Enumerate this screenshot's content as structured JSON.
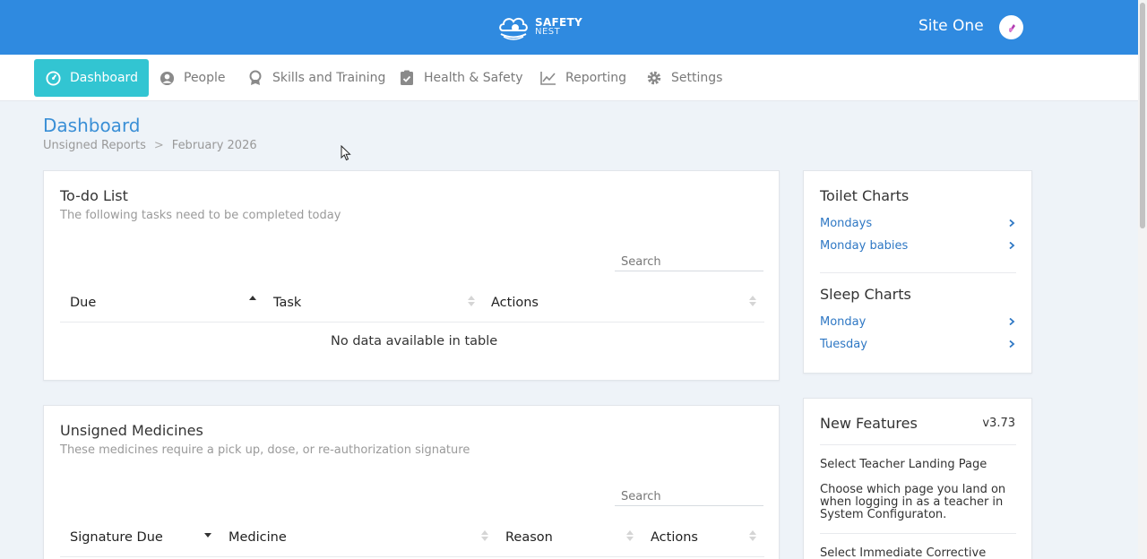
{
  "header": {
    "logo_line1": "SAFETY",
    "logo_line2": "NEST",
    "site_name": "Site One"
  },
  "nav": [
    {
      "label": "Dashboard",
      "icon": "dashboard-icon",
      "active": true
    },
    {
      "label": "People",
      "icon": "person-icon",
      "active": false
    },
    {
      "label": "Skills and Training",
      "icon": "award-icon",
      "active": false
    },
    {
      "label": "Health & Safety",
      "icon": "clipboard-check-icon",
      "active": false
    },
    {
      "label": "Reporting",
      "icon": "line-chart-icon",
      "active": false
    },
    {
      "label": "Settings",
      "icon": "gear-icon",
      "active": false
    }
  ],
  "page": {
    "title": "Dashboard",
    "breadcrumb": [
      "Unsigned Reports",
      "February 2026"
    ]
  },
  "todo": {
    "title": "To-do List",
    "subtitle": "The following tasks need to be completed today",
    "search_placeholder": "Search",
    "columns": [
      "Due",
      "Task",
      "Actions"
    ],
    "empty_message": "No data available in table"
  },
  "medicines": {
    "title": "Unsigned Medicines",
    "subtitle": "These medicines require a pick up, dose, or re-authorization signature",
    "search_placeholder": "Search",
    "columns": [
      "Signature Due",
      "Medicine",
      "Reason",
      "Actions"
    ]
  },
  "toilet_charts": {
    "title": "Toilet Charts",
    "items": [
      "Mondays",
      "Monday babies"
    ]
  },
  "sleep_charts": {
    "title": "Sleep Charts",
    "items": [
      "Monday",
      "Tuesday"
    ]
  },
  "new_features": {
    "title": "New Features",
    "version": "v3.73",
    "items": [
      {
        "title": "Select Teacher Landing Page",
        "text": "Choose which page you land on when logging in as a teacher in System Configuraton."
      },
      {
        "title": "Select Immediate Corrective"
      }
    ]
  },
  "colors": {
    "header_bg": "#2f8ae0",
    "nav_active": "#32c5d2",
    "link": "#2f78c4",
    "title_blue": "#3a8fd6"
  }
}
